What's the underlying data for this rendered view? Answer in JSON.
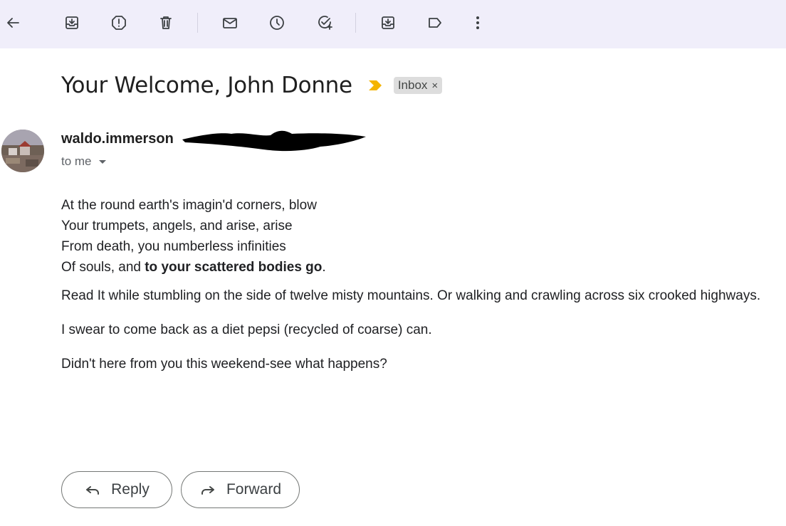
{
  "toolbar": {
    "icons": [
      "back-arrow-icon",
      "archive-icon",
      "report-spam-icon",
      "delete-icon",
      "mark-unread-icon",
      "snooze-icon",
      "add-task-icon",
      "move-to-icon",
      "label-icon",
      "more-vert-icon"
    ]
  },
  "email": {
    "subject": "Your Welcome, John Donne",
    "label": "Inbox",
    "label_remove": "×",
    "sender": "waldo.immerson",
    "to": "to me",
    "poem": {
      "line1": "At the round earth's imagin'd corners, blow",
      "line2": "Your trumpets, angels, and arise, arise",
      "line3": "From death, you numberless infinities",
      "line4_plain": "Of souls, and ",
      "line4_bold": "to your scattered bodies go",
      "line4_end": "."
    },
    "para1": "Read It while stumbling on the side of twelve misty mountains. Or walking and crawling across six crooked highways.",
    "para2": "I swear to come back as a diet pepsi (recycled of coarse) can.",
    "para3": "Didn't here from you this weekend-see what happens?"
  },
  "actions": {
    "reply": "Reply",
    "forward": "Forward"
  },
  "colors": {
    "toolbar_bg": "#f0eefa",
    "importance": "#f4b400",
    "chip_bg": "#dddddd"
  }
}
